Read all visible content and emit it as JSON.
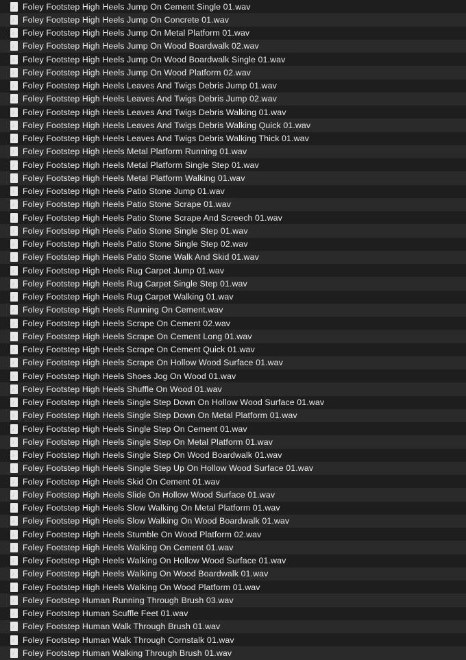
{
  "files": [
    "Foley Footstep High Heels Jump On Cement Single 01.wav",
    "Foley Footstep High Heels Jump On Concrete 01.wav",
    "Foley Footstep High Heels Jump On Metal Platform 01.wav",
    "Foley Footstep High Heels Jump On Wood Boardwalk 02.wav",
    "Foley Footstep High Heels Jump On Wood Boardwalk Single 01.wav",
    "Foley Footstep High Heels Jump On Wood Platform 02.wav",
    "Foley Footstep High Heels Leaves And Twigs Debris Jump 01.wav",
    "Foley Footstep High Heels Leaves And Twigs Debris Jump 02.wav",
    "Foley Footstep High Heels Leaves And Twigs Debris Walking 01.wav",
    "Foley Footstep High Heels Leaves And Twigs Debris Walking Quick 01.wav",
    "Foley Footstep High Heels Leaves And Twigs Debris Walking Thick 01.wav",
    "Foley Footstep High Heels Metal Platform Running 01.wav",
    "Foley Footstep High Heels Metal Platform Single Step 01.wav",
    "Foley Footstep High Heels Metal Platform Walking 01.wav",
    "Foley Footstep High Heels Patio Stone Jump 01.wav",
    "Foley Footstep High Heels Patio Stone Scrape 01.wav",
    "Foley Footstep High Heels Patio Stone Scrape And Screech 01.wav",
    "Foley Footstep High Heels Patio Stone Single Step 01.wav",
    "Foley Footstep High Heels Patio Stone Single Step 02.wav",
    "Foley Footstep High Heels Patio Stone Walk And Skid 01.wav",
    "Foley Footstep High Heels Rug Carpet Jump 01.wav",
    "Foley Footstep High Heels Rug Carpet Single Step 01.wav",
    "Foley Footstep High Heels Rug Carpet Walking 01.wav",
    "Foley Footstep High Heels Running On Cement.wav",
    "Foley Footstep High Heels Scrape On Cement 02.wav",
    "Foley Footstep High Heels Scrape On Cement Long 01.wav",
    "Foley Footstep High Heels Scrape On Cement Quick 01.wav",
    "Foley Footstep High Heels Scrape On Hollow Wood Surface 01.wav",
    "Foley Footstep High Heels Shoes Jog On Wood 01.wav",
    "Foley Footstep High Heels Shuffle On Wood 01.wav",
    "Foley Footstep High Heels Single Step Down On Hollow Wood Surface 01.wav",
    "Foley Footstep High Heels Single Step Down On Metal Platform 01.wav",
    "Foley Footstep High Heels Single Step On Cement 01.wav",
    "Foley Footstep High Heels Single Step On Metal Platform 01.wav",
    "Foley Footstep High Heels Single Step On Wood Boardwalk 01.wav",
    "Foley Footstep High Heels Single Step Up On Hollow Wood Surface 01.wav",
    "Foley Footstep High Heels Skid On Cement 01.wav",
    "Foley Footstep High Heels Slide On Hollow Wood Surface 01.wav",
    "Foley Footstep High Heels Slow Walking On Metal Platform 01.wav",
    "Foley Footstep High Heels Slow Walking On Wood Boardwalk 01.wav",
    "Foley Footstep High Heels Stumble On Wood Platform 02.wav",
    "Foley Footstep High Heels Walking On Cement 01.wav",
    "Foley Footstep High Heels Walking On Hollow Wood Surface 01.wav",
    "Foley Footstep High Heels Walking On Wood Boardwalk 01.wav",
    "Foley Footstep High Heels Walking On Wood Platform 01.wav",
    "Foley Footstep Human Running Through Brush 03.wav",
    "Foley Footstep Human Scuffle Feet 01.wav",
    "Foley Footstep Human Walk Through Brush 01.wav",
    "Foley Footstep Human Walk Through Cornstalk 01.wav",
    "Foley Footstep Human Walking Through Brush 01.wav"
  ],
  "icon": "audio-file-icon",
  "colors": {
    "background": "#1e1e1e",
    "alt_row": "#2a2a2a",
    "text": "#ececec"
  }
}
